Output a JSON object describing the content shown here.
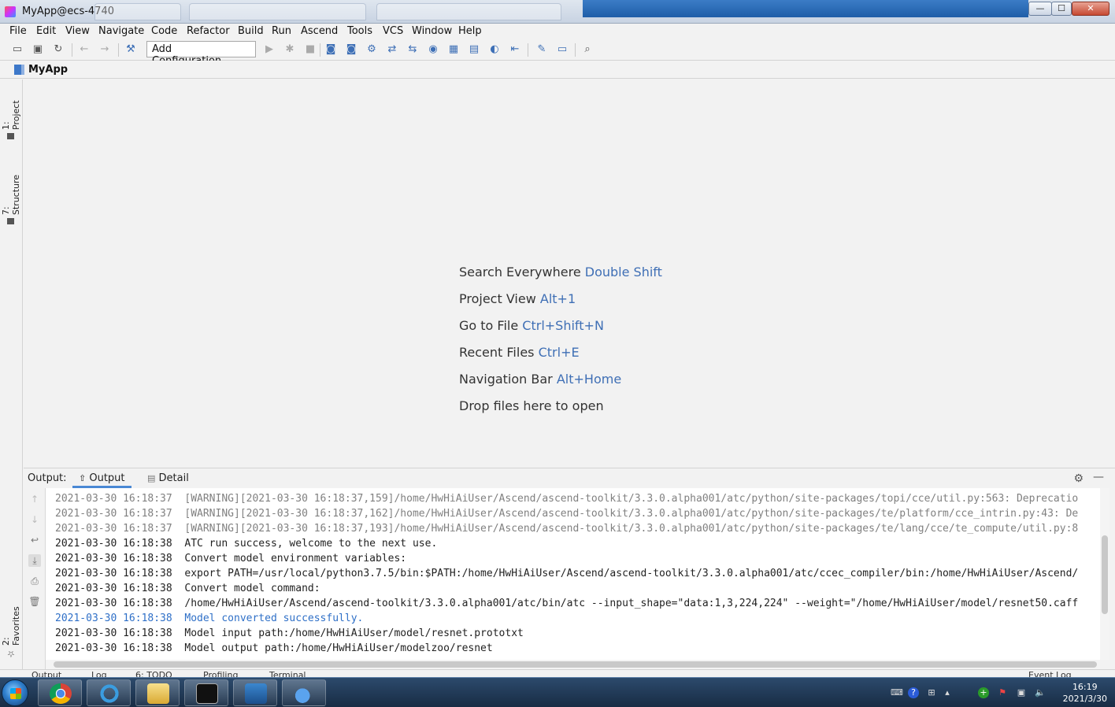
{
  "window": {
    "title": "MyApp@ecs-4740",
    "controls": {
      "minimize": "—",
      "maximize": "☐",
      "close": "✕"
    }
  },
  "menu": [
    "File",
    "Edit",
    "View",
    "Navigate",
    "Code",
    "Refactor",
    "Build",
    "Run",
    "Ascend",
    "Tools",
    "VCS",
    "Window",
    "Help"
  ],
  "toolbar": {
    "add_configuration": "Add Configuration...",
    "icons": [
      "open-folder-icon",
      "save-icon",
      "sync-icon",
      "back-arrow-icon",
      "forward-arrow-icon",
      "build-hammer-icon",
      "run-icon",
      "debug-icon",
      "stop-icon",
      "ascend-tool-icon",
      "search-icon"
    ]
  },
  "navbar": {
    "project": "MyApp"
  },
  "left_stripe": {
    "project_tab": "1: Project",
    "structure_tab": "7: Structure",
    "favorites_tab": "2: Favorites"
  },
  "welcome": {
    "hints": [
      {
        "label": "Search Everywhere",
        "shortcut": "Double Shift"
      },
      {
        "label": "Project View",
        "shortcut": "Alt+1"
      },
      {
        "label": "Go to File",
        "shortcut": "Ctrl+Shift+N"
      },
      {
        "label": "Recent Files",
        "shortcut": "Ctrl+E"
      },
      {
        "label": "Navigation Bar",
        "shortcut": "Alt+Home"
      },
      {
        "label": "Drop files here to open",
        "shortcut": ""
      }
    ]
  },
  "output": {
    "label": "Output:",
    "tabs": [
      "Output",
      "Detail"
    ],
    "lines": [
      {
        "ts": "2021-03-30 16:18:37",
        "msg": "[WARNING][2021-03-30 16:18:37,159]/home/HwHiAiUser/Ascend/ascend-toolkit/3.3.0.alpha001/atc/python/site-packages/topi/cce/util.py:563: Deprecatio",
        "style": "gray"
      },
      {
        "ts": "2021-03-30 16:18:37",
        "msg": "[WARNING][2021-03-30 16:18:37,162]/home/HwHiAiUser/Ascend/ascend-toolkit/3.3.0.alpha001/atc/python/site-packages/te/platform/cce_intrin.py:43: De",
        "style": "gray"
      },
      {
        "ts": "2021-03-30 16:18:37",
        "msg": "[WARNING][2021-03-30 16:18:37,193]/home/HwHiAiUser/Ascend/ascend-toolkit/3.3.0.alpha001/atc/python/site-packages/te/lang/cce/te_compute/util.py:8",
        "style": "gray"
      },
      {
        "ts": "2021-03-30 16:18:38",
        "msg": "ATC run success, welcome to the next use.",
        "style": "normal"
      },
      {
        "ts": "2021-03-30 16:18:38",
        "msg": "Convert model environment variables:",
        "style": "normal"
      },
      {
        "ts": "2021-03-30 16:18:38",
        "msg": "export PATH=/usr/local/python3.7.5/bin:$PATH:/home/HwHiAiUser/Ascend/ascend-toolkit/3.3.0.alpha001/atc/ccec_compiler/bin:/home/HwHiAiUser/Ascend/",
        "style": "normal"
      },
      {
        "ts": "2021-03-30 16:18:38",
        "msg": "Convert model command:",
        "style": "normal"
      },
      {
        "ts": "2021-03-30 16:18:38",
        "msg": "/home/HwHiAiUser/Ascend/ascend-toolkit/3.3.0.alpha001/atc/bin/atc --input_shape=\"data:1,3,224,224\" --weight=\"/home/HwHiAiUser/model/resnet50.caff",
        "style": "normal"
      },
      {
        "ts": "2021-03-30 16:18:38",
        "msg": "Model converted successfully.",
        "style": "blue"
      },
      {
        "ts": "2021-03-30 16:18:38",
        "msg": "Model input path:/home/HwHiAiUser/model/resnet.prototxt",
        "style": "normal"
      },
      {
        "ts": "2021-03-30 16:18:38",
        "msg": "Model output path:/home/HwHiAiUser/modelzoo/resnet",
        "style": "normal"
      }
    ]
  },
  "bottom_tabs": [
    "Output",
    "Log",
    "6: TODO",
    "Profiling",
    "Terminal",
    "Event Log"
  ],
  "taskbar": {
    "apps": [
      "chrome-icon",
      "ie-icon",
      "file-explorer-icon",
      "terminal-icon",
      "k-app-icon",
      "cloud-app-icon"
    ],
    "clock_time": "16:19",
    "clock_date": "2021/3/30"
  }
}
